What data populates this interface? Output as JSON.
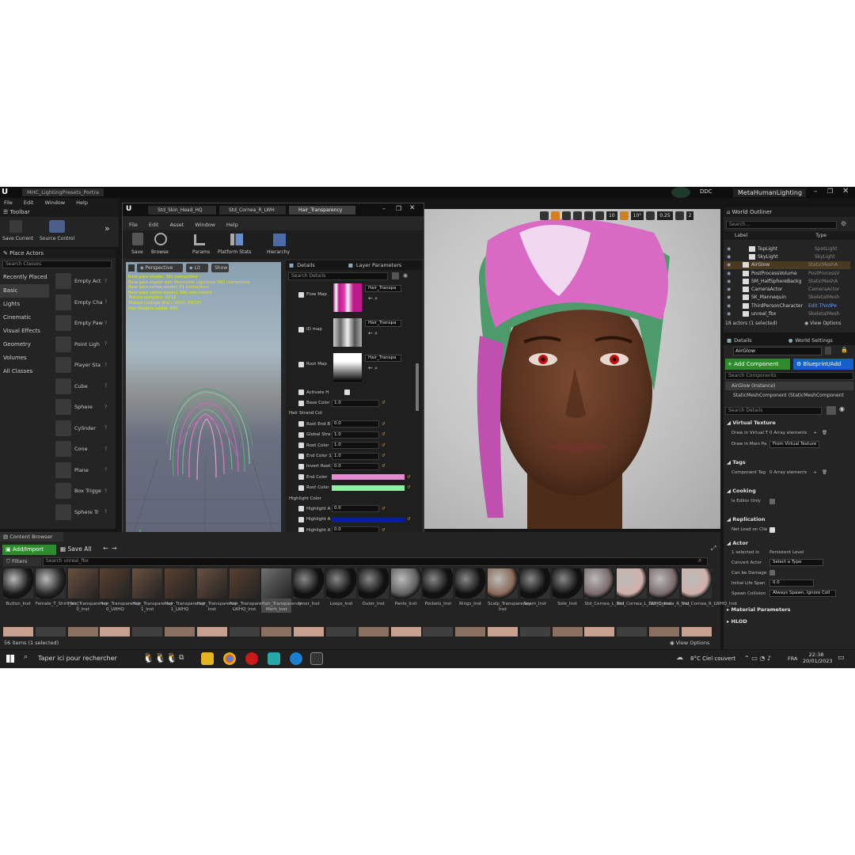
{
  "main_window": {
    "tab": "MHC_LightingPresets_Portra",
    "menu": [
      "File",
      "Edit",
      "Window",
      "Help"
    ],
    "project": "MetaHumanLighting",
    "ddc": "DDC"
  },
  "toolbar": {
    "title": "Toolbar",
    "save_current": "Save Current",
    "source_control": "Source Control"
  },
  "place_actors": {
    "title": "Place Actors",
    "search_placeholder": "Search Classes",
    "categories": [
      "Recently Placed",
      "Basic",
      "Lights",
      "Cinematic",
      "Visual Effects",
      "Geometry",
      "Volumes",
      "All Classes"
    ],
    "actors": [
      "Empty Act",
      "Empty Cha",
      "Empty Paw",
      "Point Ligh",
      "Player Sta",
      "Cube",
      "Sphere",
      "Cylinder",
      "Cone",
      "Plane",
      "Box Trigge",
      "Sphere Tr"
    ]
  },
  "material_editor": {
    "tabs": [
      "Std_Skin_Head_HQ",
      "Std_Cornea_R_LWH",
      "Hair_Transparency"
    ],
    "menu": [
      "File",
      "Edit",
      "Asset",
      "Window",
      "Help"
    ],
    "tools": [
      "Save",
      "Browse",
      "Params",
      "Platform Stats",
      "Hierarchy"
    ],
    "viewport_buttons": [
      "Perspective",
      "Lit",
      "Show"
    ],
    "stats": [
      "Base pass shader: 391 instructions",
      "Base pass shader with Volumetric Lightmap: 581 instructions",
      "Base pass vertex shader: 51 instructions",
      "Base pass vertex shader: 180 instructions",
      "Texture samplers: 10/16",
      "Texture Lookups (Est.): VS(0), PS(17)",
      "Hair Shaders added: 832"
    ],
    "details_tab": "Details",
    "layer_tab": "Layer Parameters",
    "search_details": "Search Details",
    "texture_params": [
      {
        "label": "Flow Map",
        "asset": "Hair_Transpa"
      },
      {
        "label": "ID map",
        "asset": "Hair_Transpa"
      },
      {
        "label": "Root Map",
        "asset": "Hair_Transpa"
      }
    ],
    "rows_top": [
      {
        "label": "Activate H",
        "value": ""
      },
      {
        "label": "Base Color",
        "value": "1.0"
      }
    ],
    "group_strand": "Hair Strand Col",
    "rows_strand": [
      {
        "label": "Root End B",
        "value": "0.0"
      },
      {
        "label": "Global Stre",
        "value": "1.0"
      },
      {
        "label": "Root Color",
        "value": "1.0"
      },
      {
        "label": "End Color 1",
        "value": "1.0"
      },
      {
        "label": "Invert Root",
        "value": "0.0"
      }
    ],
    "color_rows": [
      {
        "label": "End Color",
        "color": "#e48ad0"
      },
      {
        "label": "Root Color",
        "color": "#8ef0a0"
      }
    ],
    "group_highlight": "Highlight Color",
    "rows_highlight": [
      {
        "label": "Highlight A",
        "value": "0.0"
      },
      {
        "label": "Highlight A",
        "value": "",
        "color": "#0a1aa8"
      },
      {
        "label": "Highlight A",
        "value": "0.0"
      },
      {
        "label": "Highlight A",
        "value": "1.0"
      },
      {
        "label": "Highlight A",
        "value": "0.0"
      }
    ]
  },
  "viewport": {
    "values": [
      "10",
      "10°",
      "0.25",
      "2"
    ]
  },
  "world_outliner": {
    "title": "World Outliner",
    "search_placeholder": "Search...",
    "col_label": "Label",
    "col_type": "Type",
    "rows": [
      {
        "name": "TopLight",
        "type": "SpotLight"
      },
      {
        "name": "SkyLight",
        "type": "SkyLight"
      },
      {
        "name": "AirGlow",
        "type": "StaticMeshA"
      },
      {
        "name": "PostProcessVolume",
        "type": "PostProcessV"
      },
      {
        "name": "SM_HalfSphereBackg",
        "type": "StaticMeshA"
      },
      {
        "name": "CameraActor",
        "type": "CameraActor"
      },
      {
        "name": "SK_Mannequin",
        "type": "SkeletalMesh"
      },
      {
        "name": "ThirdPersonCharacter",
        "type": "Edit ThirdPe"
      },
      {
        "name": "unreal_fbx",
        "type": "SkeletalMesh"
      }
    ],
    "footer": "18 actors (1 selected)",
    "view_options": "View Options"
  },
  "details_panel": {
    "tab_details": "Details",
    "tab_world": "World Settings",
    "name": "AirGlow",
    "add_component": "+ Add Component",
    "blueprint": "Blueprint/Add",
    "search_components": "Search Components",
    "instance": "AirGlow (Instance)",
    "component": "StaticMeshComponent (StaticMeshComponent",
    "search_details": "Search Details",
    "sections": {
      "virtual_texture": "Virtual Texture",
      "tags": "Tags",
      "cooking": "Cooking",
      "replication": "Replication",
      "actor": "Actor",
      "material_params": "Material Parameters",
      "hlod": "HLOD"
    },
    "props": {
      "draw_in_vt": "Draw in Virtual T",
      "array_elements": "0 Array elements",
      "draw_in_main": "Draw in Main Pa",
      "from_vt": "From Virtual Texture",
      "component_tags": "Component Tag",
      "is_editor_only": "Is Editor Only",
      "net_load": "Net Load on Clie",
      "selected_in": "1 selected in",
      "persistent_level": "Persistent Level",
      "convert_actor": "Convert Actor",
      "select_type": "Select a Type",
      "can_be_damaged": "Can be Damage",
      "initial_life": "Initial Life Span",
      "initial_life_val": "0.0",
      "spawn_collision": "Spawn Collision",
      "spawn_val": "Always Spawn, Ignore Coll"
    }
  },
  "content_browser": {
    "title": "Content Browser",
    "add_import": "Add/Import",
    "save_all": "Save All",
    "filters": "Filters",
    "search_placeholder": "Search unreal_fbx",
    "assets": [
      "Button_Inst",
      "Female_T_Shirt_Inst",
      "Hair_Transparency 0_Inst",
      "Hair_Transparency 0_LWHQ",
      "Hair_Transparency 1_Inst",
      "Hair_Transparency 1_LWHQ",
      "Hair_Transparency Inst",
      "Hair_Transparency LWHQ_Inst",
      "Hair_Transparency Merh_Inst",
      "Inner_Inst",
      "Loops_Inst",
      "Outer_Inst",
      "Pants_Inst",
      "Pockets_Inst",
      "Rings_Inst",
      "Scalp_Transparency Inst",
      "Seam_Inst",
      "Sole_Inst",
      "Std_Cornea_L_Inst",
      "Std_Cornea_L_LWHQ_Inst",
      "Std_Cornea_R_Inst",
      "Std_Cornea_R_LWHQ_Inst"
    ],
    "footer": "56 items (1 selected)",
    "view_options": "View Options"
  },
  "taskbar": {
    "search": "Taper ici pour rechercher",
    "weather": "8°C  Ciel couvert",
    "lang": "FRA",
    "time": "22:38",
    "date": "20/01/2023"
  }
}
